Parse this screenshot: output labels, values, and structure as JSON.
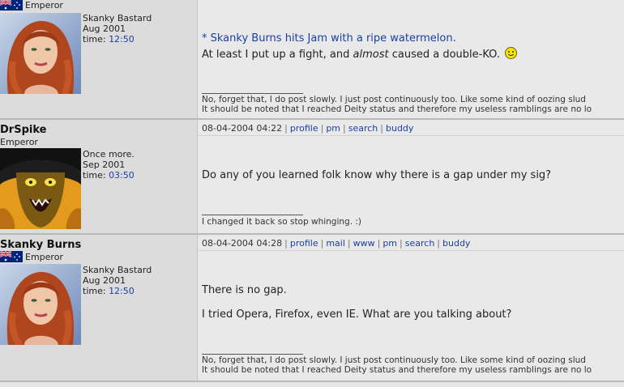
{
  "posts": [
    {
      "username": "",
      "rank": "Emperor",
      "custom_title": "Skanky Bastard",
      "joined": "Aug 2001",
      "time_label": "time:",
      "time_value": "12:50",
      "post_date": "",
      "actions": [],
      "quote_line": "* Skanky Burns hits Jam with a ripe watermelon.",
      "body_pre": "At least I put up a fight, and ",
      "body_em": "almost",
      "body_post": " caused a double-KO.",
      "sig_lines": [
        "No, forget that, I do post slowly. I just post continuously too. Like some kind of oozing slud",
        "It should be noted that I reached Deity status and therefore my useless ramblings are no lo"
      ]
    },
    {
      "username": "DrSpike",
      "rank": "Emperor",
      "custom_title": "Once more.",
      "joined": "Sep 2001",
      "time_label": "time:",
      "time_value": "03:50",
      "post_date": "08-04-2004 04:22",
      "actions": [
        "profile",
        "pm",
        "search",
        "buddy"
      ],
      "body_lines": [
        "Do any of you learned folk know why there is a gap under my sig?"
      ],
      "sig_lines": [
        "I changed it back so stop whinging. :)"
      ]
    },
    {
      "username": "Skanky Burns",
      "rank": "Emperor",
      "custom_title": "Skanky Bastard",
      "joined": "Aug 2001",
      "time_label": "time:",
      "time_value": "12:50",
      "post_date": "08-04-2004 04:28",
      "actions": [
        "profile",
        "mail",
        "www",
        "pm",
        "search",
        "buddy"
      ],
      "body_lines": [
        "There is no gap.",
        "I tried Opera, Firefox, even IE. What are you talking about?"
      ],
      "sig_lines": [
        "No, forget that, I do post slowly. I just post continuously too. Like some kind of oozing slud",
        "It should be noted that I reached Deity status and therefore my useless ramblings are no lo"
      ]
    }
  ],
  "icons": {
    "flag": "australia-flag-icon",
    "smiley": "smiley-icon",
    "avatar_redhead": "redhead-avatar-image",
    "avatar_cartoon": "cartoon-villain-avatar-image"
  },
  "colors": {
    "link": "#1a3fa8",
    "left_panel": "#dcdcdc",
    "right_panel": "#e9e9e9"
  }
}
